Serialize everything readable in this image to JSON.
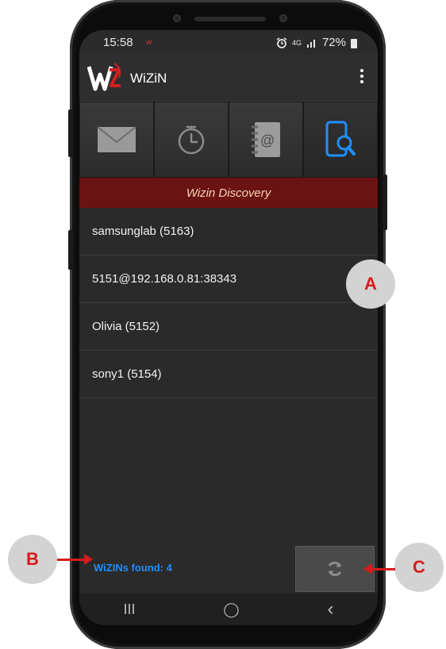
{
  "status_bar": {
    "time": "15:58",
    "indicator": "w",
    "network": "4G",
    "battery": "72%"
  },
  "app_bar": {
    "title": "WiZiN"
  },
  "nav_tabs": [
    {
      "icon": "envelope-icon",
      "active": false
    },
    {
      "icon": "clock-icon",
      "active": false
    },
    {
      "icon": "address-book-icon",
      "active": false
    },
    {
      "icon": "discovery-icon",
      "active": true
    }
  ],
  "section_header": {
    "title": "Wizin Discovery"
  },
  "devices": [
    {
      "label": "samsunglab (5163)"
    },
    {
      "label": "5151@192.168.0.81:38343"
    },
    {
      "label": "Olivia (5152)"
    },
    {
      "label": "sony1 (5154)"
    }
  ],
  "footer": {
    "found_text": "WiZINs found: 4"
  },
  "system_nav": {
    "recents": "III",
    "home": "◯",
    "back": "‹"
  },
  "callouts": {
    "a": "A",
    "b": "B",
    "c": "C"
  },
  "colors": {
    "accent_blue": "#1f8fff",
    "header_red": "#6b1212",
    "callout_red": "#d81b1b"
  }
}
